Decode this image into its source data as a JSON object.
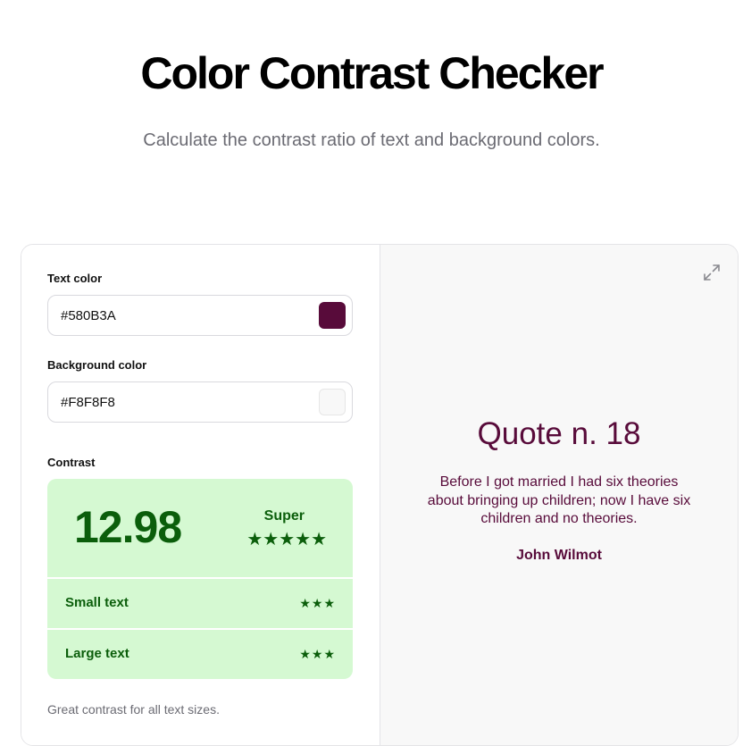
{
  "header": {
    "title": "Color Contrast Checker",
    "subtitle": "Calculate the contrast ratio of text and background colors."
  },
  "inputs": {
    "text_color_label": "Text color",
    "text_color_value": "#580B3A",
    "background_color_label": "Background color",
    "background_color_value": "#F8F8F8"
  },
  "contrast": {
    "label": "Contrast",
    "ratio": "12.98",
    "rating": "Super",
    "rating_stars": 5,
    "small_text_label": "Small text",
    "small_text_stars": 3,
    "large_text_label": "Large text",
    "large_text_stars": 3,
    "status": "Great contrast for all text sizes."
  },
  "preview": {
    "title": "Quote n. 18",
    "quote": "Before I got married I had six theories about bringing up children; now I have six children and no theories.",
    "author": "John Wilmot"
  },
  "icons": {
    "expand": "expand-icon",
    "star": "star-icon"
  },
  "colors": {
    "text": "#580B3A",
    "background": "#F8F8F8",
    "contrast_bg": "#D5F9D2",
    "contrast_fg": "#0B5E0B",
    "divider": "#ffffff"
  }
}
